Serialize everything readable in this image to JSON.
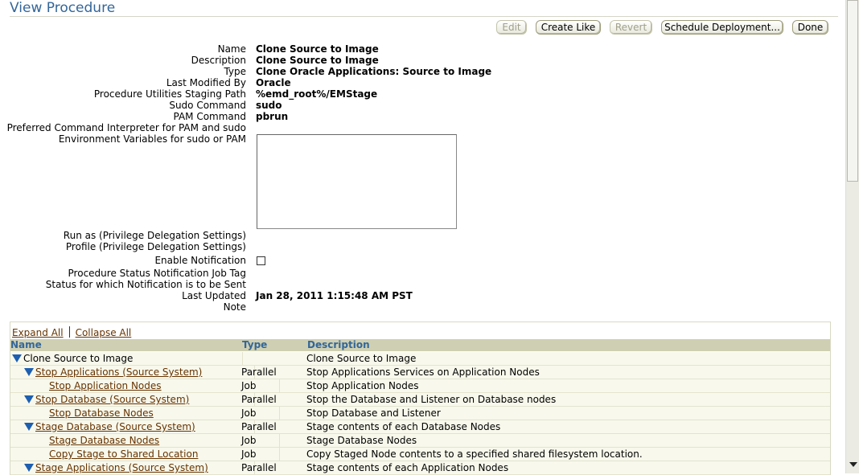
{
  "page": {
    "title": "View Procedure"
  },
  "toolbar": {
    "edit": "Edit",
    "create_like": "Create Like",
    "revert": "Revert",
    "schedule": "Schedule Deployment...",
    "done": "Done"
  },
  "properties": {
    "name_label": "Name",
    "name_value": "Clone Source to Image",
    "description_label": "Description",
    "description_value": "Clone Source to Image",
    "type_label": "Type",
    "type_value": "Clone Oracle Applications: Source to Image",
    "modified_label": "Last Modified By",
    "modified_value": "Oracle",
    "staging_label": "Procedure Utilities Staging Path",
    "staging_value": "%emd_root%/EMStage",
    "sudo_label": "Sudo Command",
    "sudo_value": "sudo",
    "pam_label": "PAM Command",
    "pam_value": "pbrun",
    "interpreter_label": "Preferred Command Interpreter for PAM and sudo",
    "env_label": "Environment Variables for sudo or PAM",
    "runas_label": "Run as (Privilege Delegation Settings)",
    "profile_label": "Profile (Privilege Delegation Settings)",
    "notify_label": "Enable Notification",
    "jobtag_label": "Procedure Status Notification Job Tag",
    "status_label": "Status for which Notification is to be Sent",
    "updated_label": "Last Updated",
    "updated_value": "Jan 28, 2011 1:15:48 AM PST",
    "note_label": "Note"
  },
  "tree": {
    "expand_all": "Expand All",
    "collapse_all": "Collapse All",
    "columns": {
      "name": "Name",
      "type": "Type",
      "description": "Description"
    },
    "rows": [
      {
        "name": "Clone Source to Image",
        "type": "",
        "description": "Clone Source to Image"
      },
      {
        "name": "Stop Applications (Source System)",
        "type": "Parallel",
        "description": "Stop Applications Services on Application Nodes"
      },
      {
        "name": "Stop Application Nodes",
        "type": "Job",
        "description": "Stop Application Nodes"
      },
      {
        "name": "Stop Database (Source System)",
        "type": "Parallel",
        "description": "Stop the Database and Listener on Database nodes"
      },
      {
        "name": "Stop Database Nodes",
        "type": "Job",
        "description": "Stop Database and Listener"
      },
      {
        "name": "Stage Database (Source System)",
        "type": "Parallel",
        "description": "Stage contents of each Database Nodes"
      },
      {
        "name": "Stage Database Nodes",
        "type": "Job",
        "description": "Stage Database Nodes"
      },
      {
        "name": "Copy Stage to Shared Location",
        "type": "Job",
        "description": "Copy Staged Node contents to a specified shared filesystem location."
      },
      {
        "name": "Stage Applications (Source System)",
        "type": "Parallel",
        "description": "Stage contents of each Application Nodes"
      }
    ]
  }
}
